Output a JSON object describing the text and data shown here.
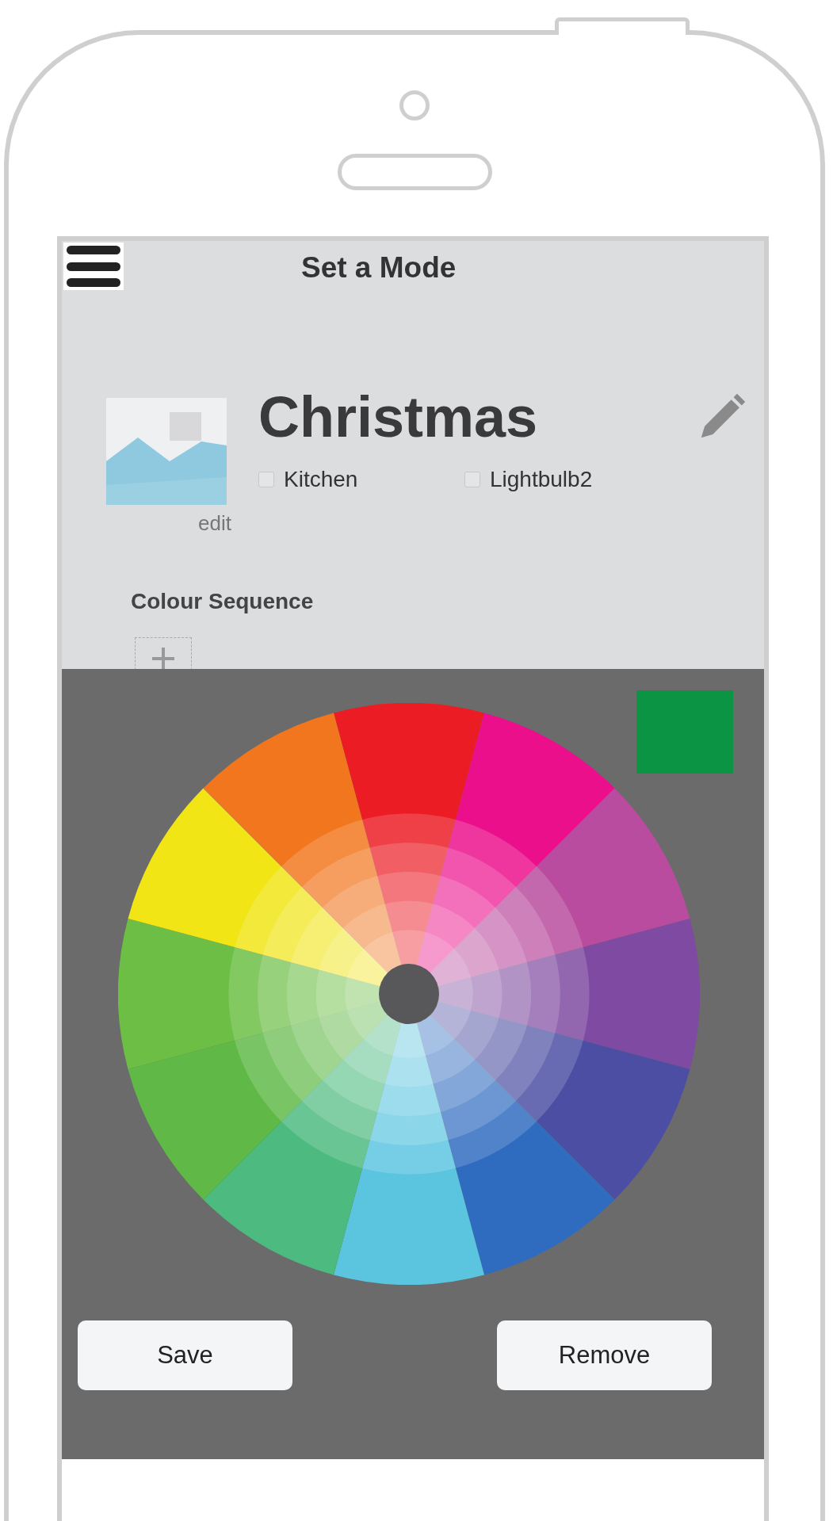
{
  "header": {
    "title": "Set a Mode"
  },
  "mode": {
    "name": "Christmas",
    "image_action": "edit"
  },
  "lights": [
    {
      "label": "Kitchen",
      "checked": false
    },
    {
      "label": "Lightbulb2",
      "checked": false
    }
  ],
  "section": {
    "title": "Colour Sequence"
  },
  "picker": {
    "swatch": {
      "color": "#0b9444"
    },
    "buttons": [
      "Save",
      "Remove"
    ]
  }
}
